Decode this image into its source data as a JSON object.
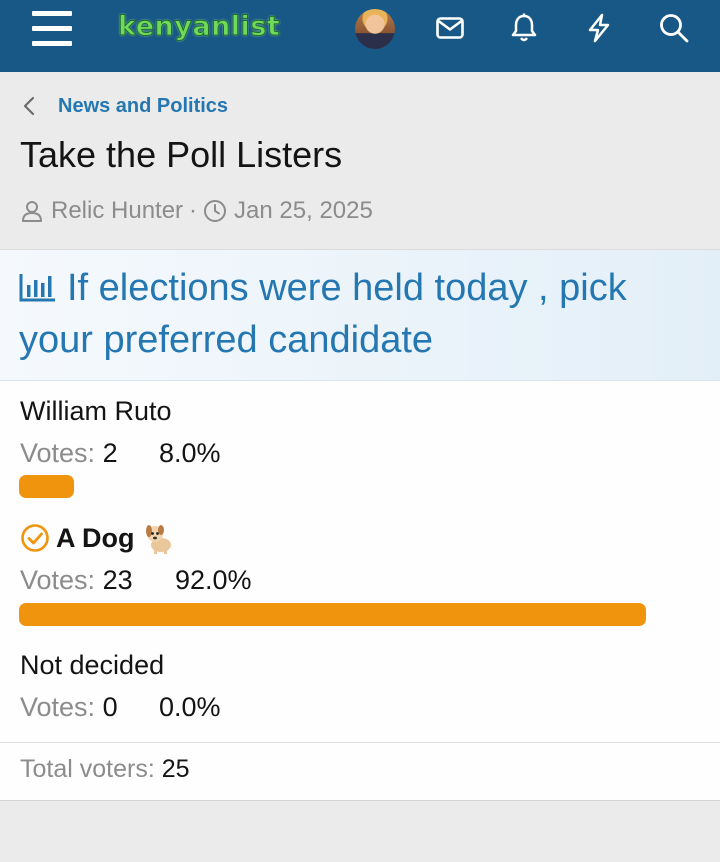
{
  "header": {
    "logo_text": "kenyanlist",
    "background_color": "#185886",
    "icons": [
      "menu-icon",
      "avatar",
      "envelope-icon",
      "bell-icon",
      "bolt-icon",
      "search-icon"
    ]
  },
  "breadcrumb": {
    "label": "News and Politics"
  },
  "thread": {
    "title": "Take the Poll Listers",
    "author": "Relic Hunter",
    "separator": "·",
    "date": "Jan 25, 2025"
  },
  "poll": {
    "question": "If elections were held today , pick your preferred candidate",
    "accent_color": "#f0940e",
    "votes_label": "Votes:",
    "options": [
      {
        "name": "William Ruto",
        "votes": "2",
        "percent": "8.0%",
        "share": 0.08,
        "selected": false
      },
      {
        "name": "A Dog",
        "emoji": "🐕",
        "votes": "23",
        "percent": "92.0%",
        "share": 0.92,
        "selected": true
      },
      {
        "name": "Not decided",
        "votes": "0",
        "percent": "0.0%",
        "share": 0.0,
        "selected": false
      }
    ],
    "total_label": "Total voters:",
    "total_value": "25"
  }
}
